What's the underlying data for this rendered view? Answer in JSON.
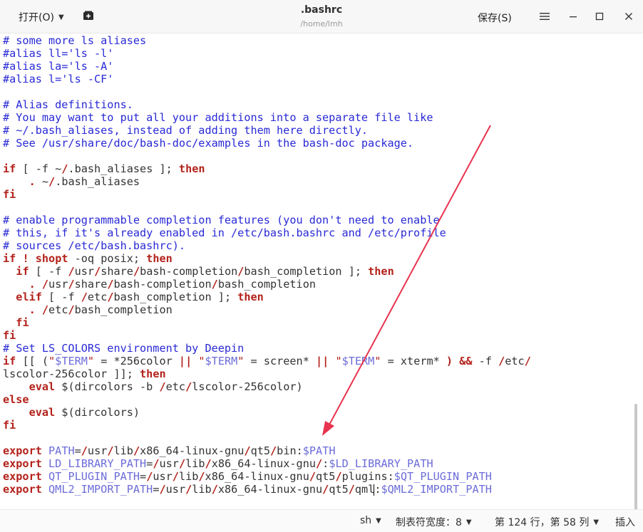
{
  "titlebar": {
    "open_menu": "打开(O)",
    "filename": ".bashrc",
    "path": "/home/lmh",
    "save_button": "保存(S)"
  },
  "editor": {
    "lines": [
      [
        [
          "c",
          "# some more ls aliases"
        ]
      ],
      [
        [
          "c",
          "#alias ll='ls -l'"
        ]
      ],
      [
        [
          "c",
          "#alias la='ls -A'"
        ]
      ],
      [
        [
          "c",
          "#alias l='ls -CF'"
        ]
      ],
      [],
      [
        [
          "c",
          "# Alias definitions."
        ]
      ],
      [
        [
          "c",
          "# You may want to put all your additions into a separate file like"
        ]
      ],
      [
        [
          "c",
          "# ~/.bash_aliases, instead of adding them here directly."
        ]
      ],
      [
        [
          "c",
          "# See /usr/share/doc/bash-doc/examples in the bash-doc package."
        ]
      ],
      [],
      [
        [
          "k",
          "if"
        ],
        [
          "p",
          " [ -f ~"
        ],
        [
          "k",
          "/"
        ],
        [
          "p",
          ".bash_aliases ]; "
        ],
        [
          "k",
          "then"
        ]
      ],
      [
        [
          "p",
          "    "
        ],
        [
          "k",
          "."
        ],
        [
          "p",
          " ~"
        ],
        [
          "k",
          "/"
        ],
        [
          "p",
          ".bash_aliases"
        ]
      ],
      [
        [
          "k",
          "fi"
        ]
      ],
      [],
      [
        [
          "c",
          "# enable programmable completion features (you don't need to enable"
        ]
      ],
      [
        [
          "c",
          "# this, if it's already enabled in /etc/bash.bashrc and /etc/profile"
        ]
      ],
      [
        [
          "c",
          "# sources /etc/bash.bashrc)."
        ]
      ],
      [
        [
          "k",
          "if"
        ],
        [
          "p",
          " "
        ],
        [
          "k",
          "!"
        ],
        [
          "p",
          " "
        ],
        [
          "k",
          "shopt"
        ],
        [
          "p",
          " -oq posix; "
        ],
        [
          "k",
          "then"
        ]
      ],
      [
        [
          "p",
          "  "
        ],
        [
          "k",
          "if"
        ],
        [
          "p",
          " [ -f "
        ],
        [
          "k",
          "/"
        ],
        [
          "p",
          "usr"
        ],
        [
          "k",
          "/"
        ],
        [
          "p",
          "share"
        ],
        [
          "k",
          "/"
        ],
        [
          "p",
          "bash-completion"
        ],
        [
          "k",
          "/"
        ],
        [
          "p",
          "bash_completion ]; "
        ],
        [
          "k",
          "then"
        ]
      ],
      [
        [
          "p",
          "    "
        ],
        [
          "k",
          "."
        ],
        [
          "p",
          " "
        ],
        [
          "k",
          "/"
        ],
        [
          "p",
          "usr"
        ],
        [
          "k",
          "/"
        ],
        [
          "p",
          "share"
        ],
        [
          "k",
          "/"
        ],
        [
          "p",
          "bash-completion"
        ],
        [
          "k",
          "/"
        ],
        [
          "p",
          "bash_completion"
        ]
      ],
      [
        [
          "p",
          "  "
        ],
        [
          "k",
          "elif"
        ],
        [
          "p",
          " [ -f "
        ],
        [
          "k",
          "/"
        ],
        [
          "p",
          "etc"
        ],
        [
          "k",
          "/"
        ],
        [
          "p",
          "bash_completion ]; "
        ],
        [
          "k",
          "then"
        ]
      ],
      [
        [
          "p",
          "    "
        ],
        [
          "k",
          "."
        ],
        [
          "p",
          " "
        ],
        [
          "k",
          "/"
        ],
        [
          "p",
          "etc"
        ],
        [
          "k",
          "/"
        ],
        [
          "p",
          "bash_completion"
        ]
      ],
      [
        [
          "p",
          "  "
        ],
        [
          "k",
          "fi"
        ]
      ],
      [
        [
          "k",
          "fi"
        ]
      ],
      [
        [
          "c",
          "# Set LS_COLORS environment by Deepin"
        ]
      ],
      [
        [
          "k",
          "if"
        ],
        [
          "p",
          " [[ ("
        ],
        [
          "s",
          "\""
        ],
        [
          "v",
          "$TERM"
        ],
        [
          "s",
          "\""
        ],
        [
          "p",
          " = *256color "
        ],
        [
          "k",
          "||"
        ],
        [
          "p",
          " "
        ],
        [
          "s",
          "\""
        ],
        [
          "v",
          "$TERM"
        ],
        [
          "s",
          "\""
        ],
        [
          "p",
          " = screen* "
        ],
        [
          "k",
          "||"
        ],
        [
          "p",
          " "
        ],
        [
          "s",
          "\""
        ],
        [
          "v",
          "$TERM"
        ],
        [
          "s",
          "\""
        ],
        [
          "p",
          " = xterm* "
        ],
        [
          "k",
          ")"
        ],
        [
          "p",
          " "
        ],
        [
          "k",
          "&&"
        ],
        [
          "p",
          " -f "
        ],
        [
          "k",
          "/"
        ],
        [
          "p",
          "etc"
        ],
        [
          "k",
          "/"
        ]
      ],
      [
        [
          "p",
          "lscolor-256color ]]; "
        ],
        [
          "k",
          "then"
        ]
      ],
      [
        [
          "p",
          "    "
        ],
        [
          "k",
          "eval"
        ],
        [
          "p",
          " $(dircolors -b "
        ],
        [
          "k",
          "/"
        ],
        [
          "p",
          "etc"
        ],
        [
          "k",
          "/"
        ],
        [
          "p",
          "lscolor-256color)"
        ]
      ],
      [
        [
          "k",
          "else"
        ]
      ],
      [
        [
          "p",
          "    "
        ],
        [
          "k",
          "eval"
        ],
        [
          "p",
          " $(dircolors)"
        ]
      ],
      [
        [
          "k",
          "fi"
        ]
      ],
      [],
      [
        [
          "k",
          "export"
        ],
        [
          "p",
          " "
        ],
        [
          "v",
          "PATH"
        ],
        [
          "p",
          "="
        ],
        [
          "k",
          "/"
        ],
        [
          "p",
          "usr"
        ],
        [
          "k",
          "/"
        ],
        [
          "p",
          "lib"
        ],
        [
          "k",
          "/"
        ],
        [
          "p",
          "x86_64-linux-gnu"
        ],
        [
          "k",
          "/"
        ],
        [
          "p",
          "qt5"
        ],
        [
          "k",
          "/"
        ],
        [
          "p",
          "bin:"
        ],
        [
          "v",
          "$PATH"
        ]
      ],
      [
        [
          "k",
          "export"
        ],
        [
          "p",
          " "
        ],
        [
          "v",
          "LD_LIBRARY_PATH"
        ],
        [
          "p",
          "="
        ],
        [
          "k",
          "/"
        ],
        [
          "p",
          "usr"
        ],
        [
          "k",
          "/"
        ],
        [
          "p",
          "lib"
        ],
        [
          "k",
          "/"
        ],
        [
          "p",
          "x86_64-linux-gnu"
        ],
        [
          "k",
          "/"
        ],
        [
          "p",
          ":"
        ],
        [
          "v",
          "$LD_LIBRARY_PATH"
        ]
      ],
      [
        [
          "k",
          "export"
        ],
        [
          "p",
          " "
        ],
        [
          "v",
          "QT_PLUGIN_PATH"
        ],
        [
          "p",
          "="
        ],
        [
          "k",
          "/"
        ],
        [
          "p",
          "usr"
        ],
        [
          "k",
          "/"
        ],
        [
          "p",
          "lib"
        ],
        [
          "k",
          "/"
        ],
        [
          "p",
          "x86_64-linux-gnu"
        ],
        [
          "k",
          "/"
        ],
        [
          "p",
          "qt5"
        ],
        [
          "k",
          "/"
        ],
        [
          "p",
          "plugins:"
        ],
        [
          "v",
          "$QT_PLUGIN_PATH"
        ]
      ],
      [
        [
          "k",
          "export"
        ],
        [
          "p",
          " "
        ],
        [
          "v",
          "QML2_IMPORT_PATH"
        ],
        [
          "p",
          "="
        ],
        [
          "k",
          "/"
        ],
        [
          "p",
          "usr"
        ],
        [
          "k",
          "/"
        ],
        [
          "p",
          "lib"
        ],
        [
          "k",
          "/"
        ],
        [
          "p",
          "x86_64-linux-gnu"
        ],
        [
          "k",
          "/"
        ],
        [
          "p",
          "qt5"
        ],
        [
          "k",
          "/"
        ],
        [
          "p",
          "qml"
        ],
        [
          "cursor",
          ""
        ],
        [
          "p",
          ":"
        ],
        [
          "v",
          "$QML2_IMPORT_PATH"
        ]
      ]
    ]
  },
  "statusbar": {
    "language": "sh",
    "tab_width_label": "制表符宽度：8",
    "position": "第 124 行，第 58 列",
    "mode": "插入"
  },
  "colors": {
    "comment": "#2929d6",
    "keyword": "#b3221b",
    "variable": "#6c6cd9",
    "annotation_arrow": "#e8344f"
  }
}
